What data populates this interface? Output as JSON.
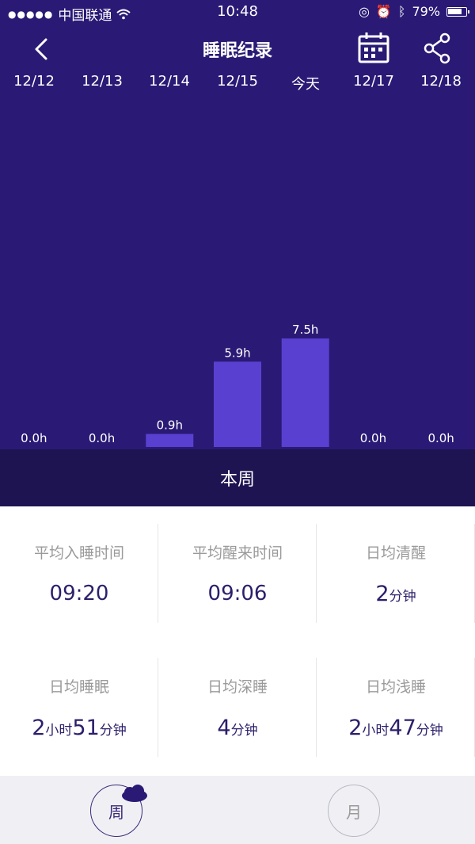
{
  "status_bar": {
    "carrier": "中国联通",
    "time": "10:48",
    "battery": "79%"
  },
  "nav": {
    "title": "睡眠纪录",
    "back_icon": "chevron-left-icon",
    "calendar_icon": "calendar-icon",
    "share_icon": "share-icon"
  },
  "chart_data": {
    "type": "bar",
    "categories": [
      "12/12",
      "12/13",
      "12/14",
      "12/15",
      "今天",
      "12/17",
      "12/18"
    ],
    "values": [
      0.0,
      0.0,
      0.9,
      5.9,
      7.5,
      0.0,
      0.0
    ],
    "labels": [
      "0.0h",
      "0.0h",
      "0.9h",
      "5.9h",
      "7.5h",
      "0.0h",
      "0.0h"
    ],
    "bar_color": "#5a40d0",
    "background": "#2a1a75"
  },
  "week_label": "本周",
  "stats": {
    "avg_sleep_time": {
      "label": "平均入睡时间",
      "value": "09:20"
    },
    "avg_wake_time": {
      "label": "平均醒来时间",
      "value": "09:06"
    },
    "daily_awake": {
      "label": "日均清醒",
      "num": "2",
      "unit": "分钟"
    },
    "daily_sleep": {
      "label": "日均睡眠",
      "num1": "2",
      "unit1": "小时",
      "num2": "51",
      "unit2": "分钟"
    },
    "daily_deep": {
      "label": "日均深睡",
      "num": "4",
      "unit": "分钟"
    },
    "daily_light": {
      "label": "日均浅睡",
      "num1": "2",
      "unit1": "小时",
      "num2": "47",
      "unit2": "分钟"
    }
  },
  "tabs": {
    "week": "周",
    "month": "月"
  },
  "colors": {
    "accent": "#2b1f6b",
    "header": "#2a1a75",
    "week_band": "#1e1452"
  }
}
